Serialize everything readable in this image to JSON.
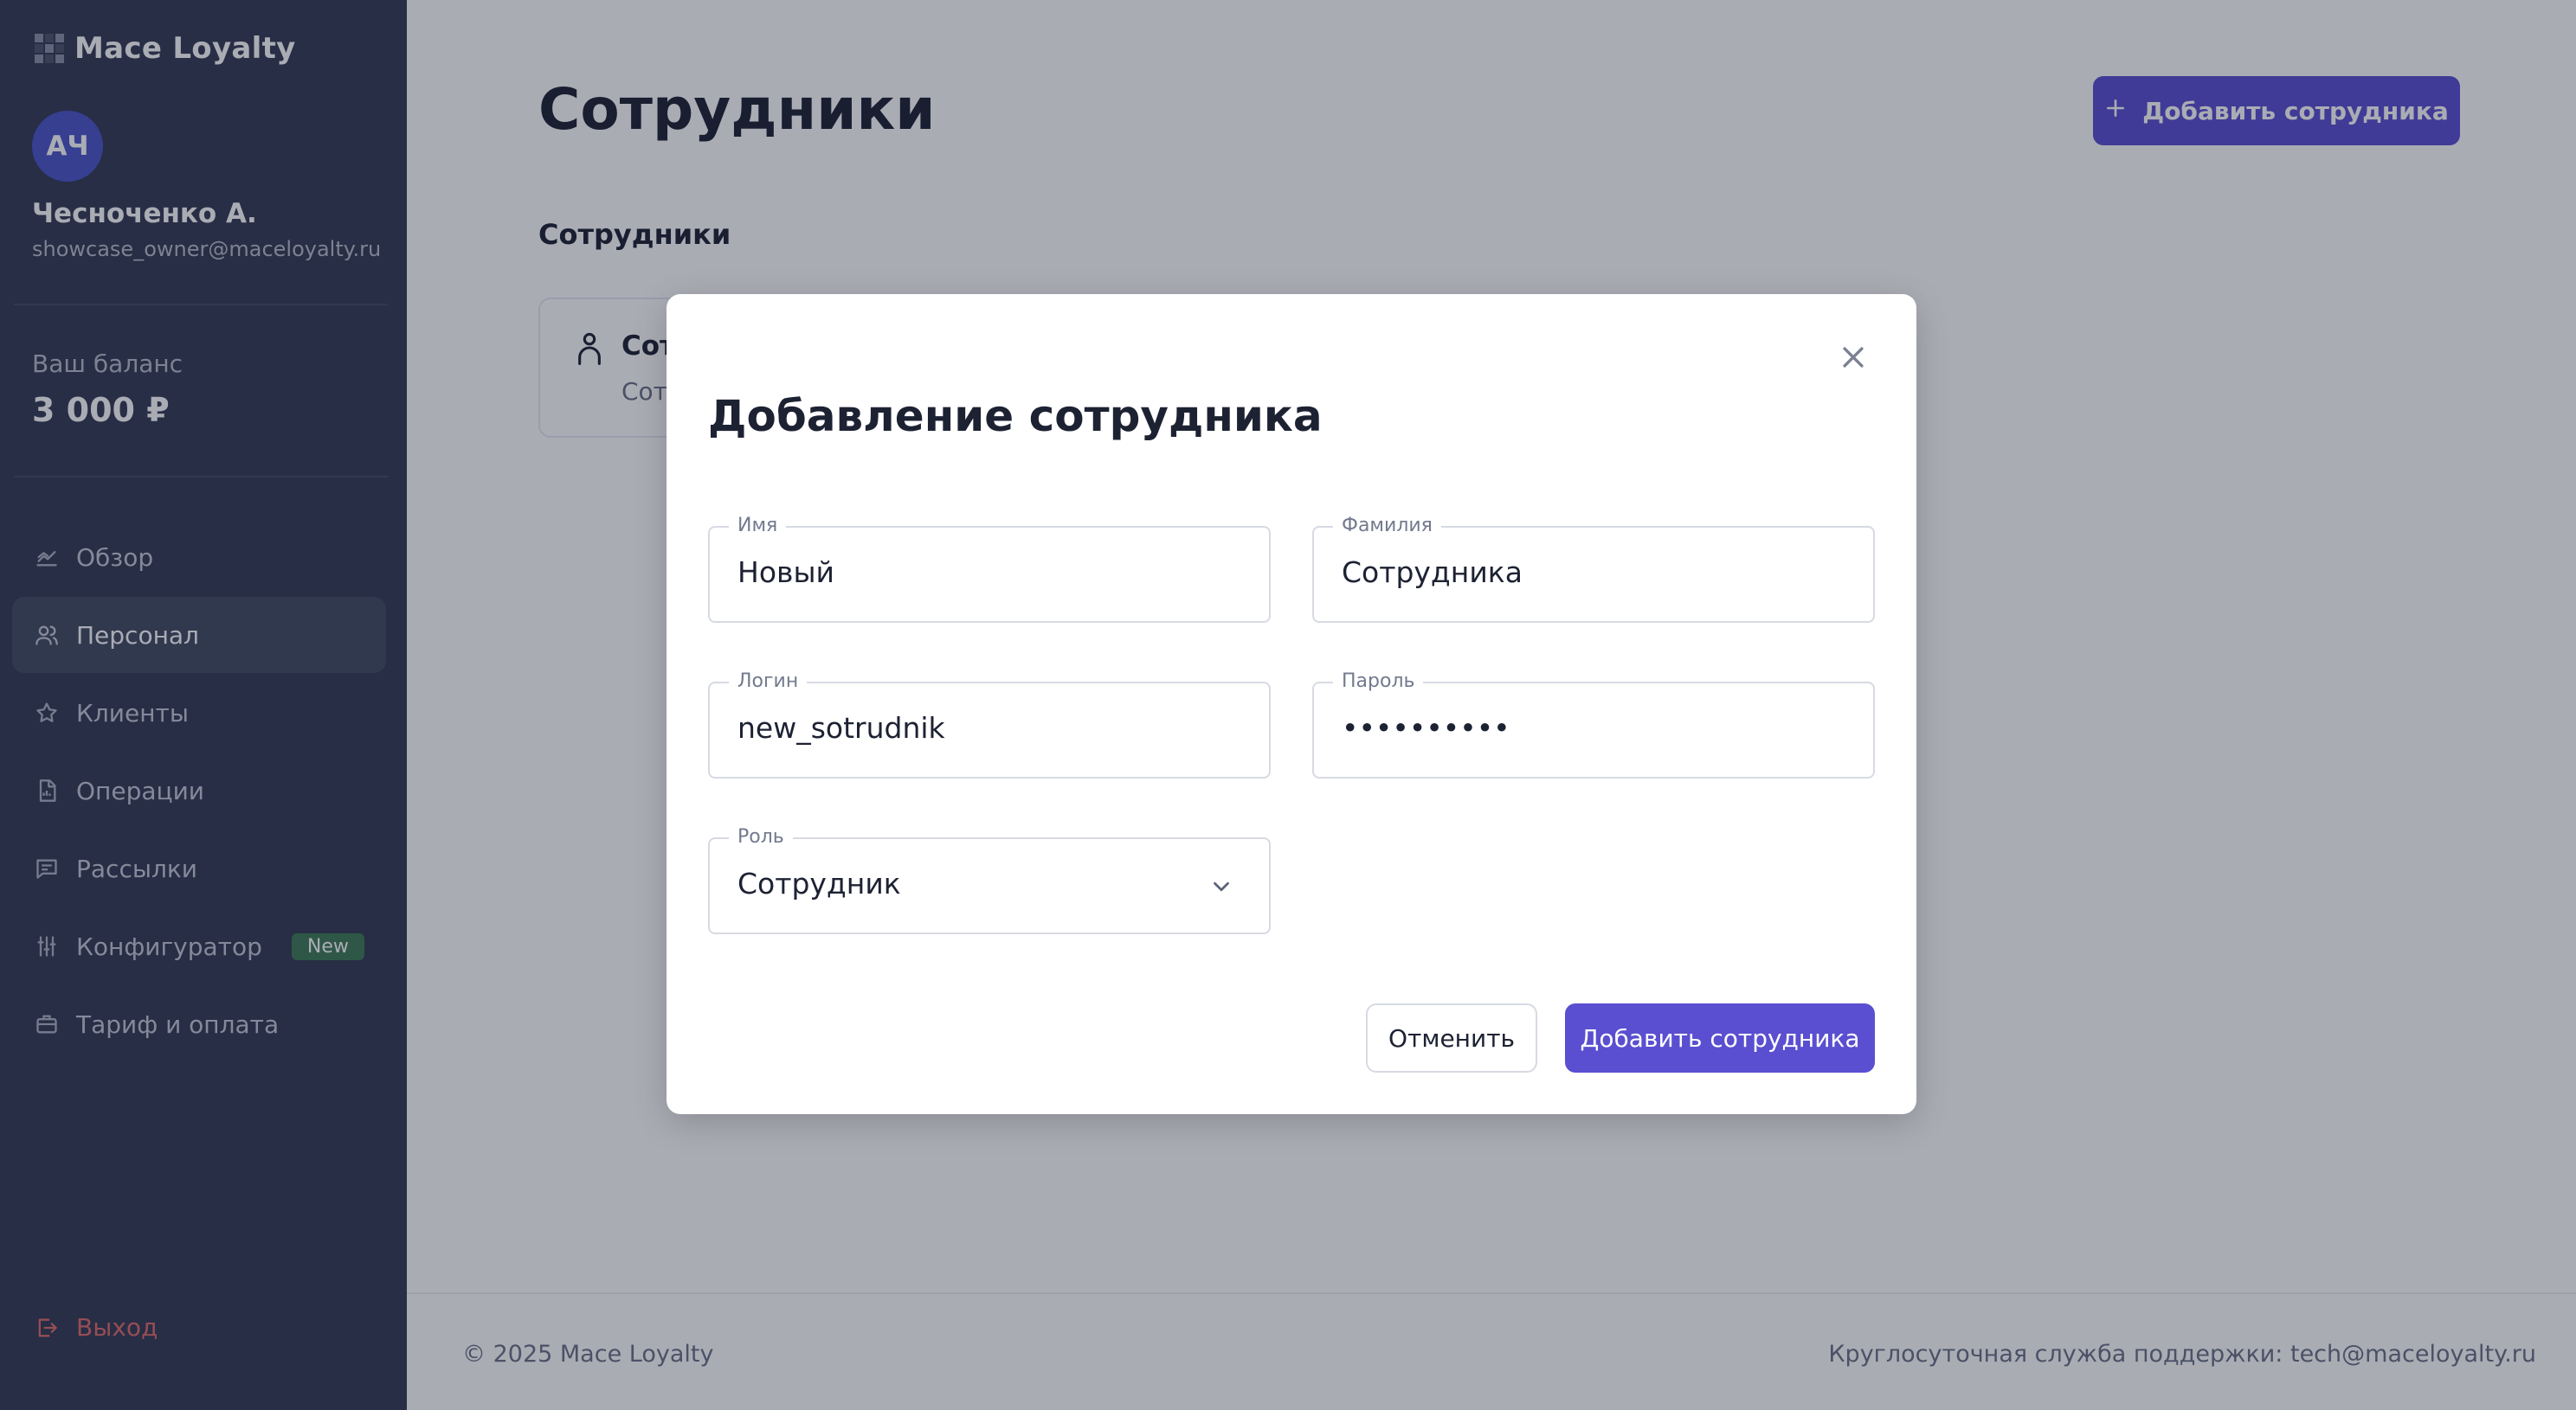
{
  "brand": {
    "name": "Mace Loyalty"
  },
  "user": {
    "initials": "АЧ",
    "name": "Чесноченко А.",
    "email": "showcase_owner@maceloyalty.ru"
  },
  "balance": {
    "label": "Ваш баланс",
    "value": "3 000 ₽"
  },
  "nav": {
    "items": [
      {
        "label": "Обзор",
        "icon": "chart-icon",
        "active": false
      },
      {
        "label": "Персонал",
        "icon": "users-icon",
        "active": true
      },
      {
        "label": "Клиенты",
        "icon": "star-icon",
        "active": false
      },
      {
        "label": "Операции",
        "icon": "document-icon",
        "active": false
      },
      {
        "label": "Рассылки",
        "icon": "message-icon",
        "active": false
      },
      {
        "label": "Конфигуратор",
        "icon": "sliders-icon",
        "active": false,
        "badge": "New"
      },
      {
        "label": "Тариф и оплата",
        "icon": "briefcase-icon",
        "active": false
      }
    ],
    "logout_label": "Выход"
  },
  "page": {
    "title": "Сотрудники",
    "add_button_label": "Добавить сотрудника",
    "section_title": "Сотрудники",
    "staff_card": {
      "name": "Сот",
      "role": "Сот"
    }
  },
  "footer": {
    "copyright": "© 2025 Mace Loyalty",
    "support": "Круглосуточная служба поддержки: tech@maceloyalty.ru"
  },
  "modal": {
    "title": "Добавление сотрудника",
    "fields": {
      "first_name": {
        "label": "Имя",
        "value": "Новый"
      },
      "last_name": {
        "label": "Фамилия",
        "value": "Сотрудника"
      },
      "login": {
        "label": "Логин",
        "value": "new_sotrudnik"
      },
      "password": {
        "label": "Пароль",
        "value": "••••••••••"
      },
      "role": {
        "label": "Роль",
        "value": "Сотрудник"
      }
    },
    "cancel_label": "Отменить",
    "submit_label": "Добавить сотрудника"
  },
  "colors": {
    "sidebar_bg": "#323a52",
    "accent": "#5a4fd0",
    "avatar": "#4b55c8",
    "badge_new": "#3f7a55",
    "logout": "#e06b6b"
  }
}
